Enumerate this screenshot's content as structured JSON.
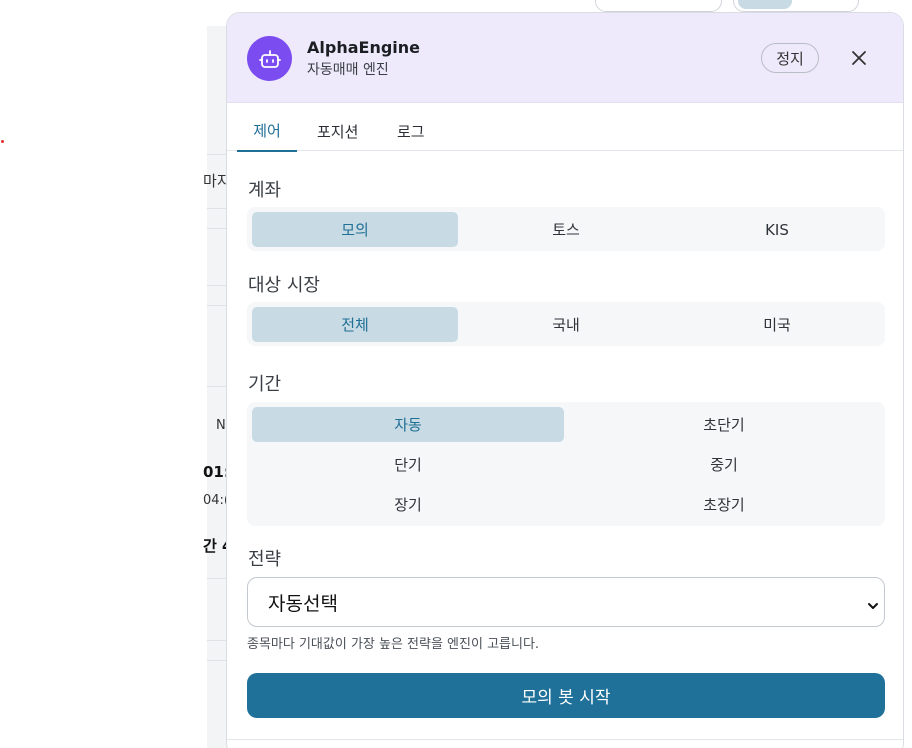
{
  "background": {
    "fragments": [
      "마지",
      "N",
      "01:",
      "04:(",
      "간 4"
    ]
  },
  "panel": {
    "title": "AlphaEngine",
    "subtitle": "자동매매 엔진",
    "stop_label": "정지",
    "close_icon": "close-icon",
    "avatar_icon": "robot-icon",
    "accent_color": "#7b4df0",
    "primary_color": "#1f7199"
  },
  "tabs": [
    {
      "label": "제어",
      "active": true
    },
    {
      "label": "포지션",
      "active": false
    },
    {
      "label": "로그",
      "active": false
    }
  ],
  "account": {
    "label": "계좌",
    "options": [
      "모의",
      "토스",
      "KIS"
    ],
    "selected": "모의"
  },
  "market": {
    "label": "대상 시장",
    "options": [
      "전체",
      "국내",
      "미국"
    ],
    "selected": "전체"
  },
  "period": {
    "label": "기간",
    "options": [
      "자동",
      "초단기",
      "단기",
      "중기",
      "장기",
      "초장기"
    ],
    "selected": "자동"
  },
  "strategy": {
    "label": "전략",
    "value": "자동선택",
    "hint": "종목마다 기대값이 가장 높은 전략을 엔진이 고릅니다."
  },
  "start_button": "모의 봇 시작"
}
